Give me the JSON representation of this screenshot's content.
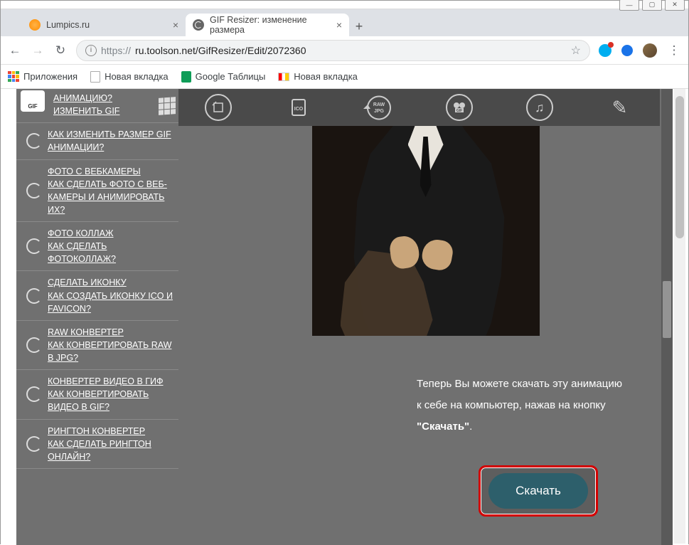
{
  "window": {
    "min": "—",
    "max": "▢",
    "close": "✕"
  },
  "tabs": {
    "tab1": "Lumpics.ru",
    "tab2": "GIF Resizer: изменение размера",
    "close": "×",
    "new": "+"
  },
  "nav": {
    "back": "←",
    "fwd": "→",
    "reload": "↻"
  },
  "url": {
    "info": "i",
    "scheme": "https://",
    "rest": "ru.toolson.net/GifResizer/Edit/2072360",
    "star": "☆",
    "menu": "⋮"
  },
  "bookmarks": {
    "apps": "Приложения",
    "newtab": "Новая вкладка",
    "sheets": "Google Таблицы",
    "newtab2": "Новая вкладка"
  },
  "toolbar": {
    "ico": "ICO",
    "rawjpg": "RAW JPG",
    "gif": "GIF",
    "music": "♫",
    "pencil": "✎"
  },
  "sidebar": {
    "items": [
      {
        "title": "АНИМАЦИЮ?",
        "sub": "ИЗМЕНИТЬ GIF"
      },
      {
        "title": "КАК ИЗМЕНИТЬ РАЗМЕР GIF АНИМАЦИИ?",
        "sub": ""
      },
      {
        "title": "ФОТО С ВЕБКАМЕРЫ",
        "sub": "КАК СДЕЛАТЬ ФОТО С ВЕБ-КАМЕРЫ И АНИМИРОВАТЬ ИХ?"
      },
      {
        "title": "ФОТО КОЛЛАЖ",
        "sub": "КАК СДЕЛАТЬ ФОТОКОЛЛАЖ?"
      },
      {
        "title": "СДЕЛАТЬ ИКОНКУ",
        "sub": "КАК СОЗДАТЬ ИКОНКУ ICO И FAVICON?"
      },
      {
        "title": "RAW КОНВЕРТЕР",
        "sub": "КАК КОНВЕРТИРОВАТЬ RAW В JPG?"
      },
      {
        "title": "КОНВЕРТЕР ВИДЕО В ГИФ",
        "sub": "КАК КОНВЕРТИРОВАТЬ ВИДЕО В GIF?"
      },
      {
        "title": "РИНГТОН КОНВЕРТЕР",
        "sub": "КАК СДЕЛАТЬ РИНГТОН ОНЛАЙН?"
      }
    ]
  },
  "main": {
    "instruction_pre": "Теперь Вы можете скачать эту анимацию к себе на компьютер, нажав на кнопку ",
    "instruction_bold": "\"Скачать\"",
    "instruction_post": ".",
    "download": "Скачать"
  }
}
